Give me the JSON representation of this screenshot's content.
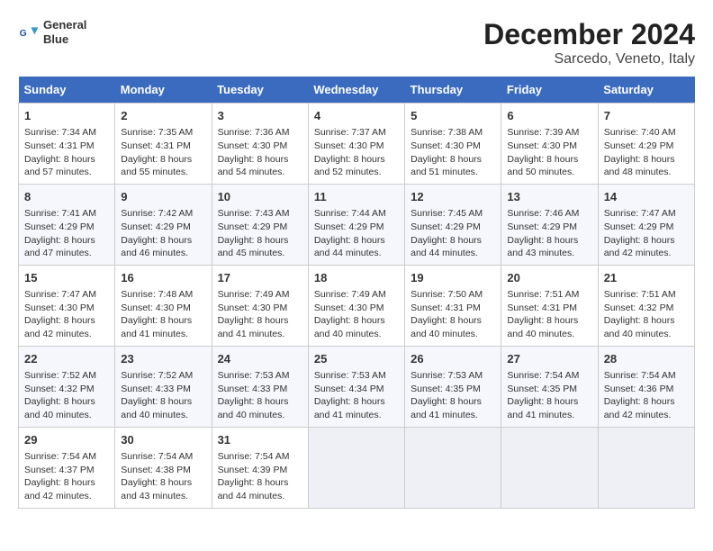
{
  "logo": {
    "line1": "General",
    "line2": "Blue"
  },
  "title": "December 2024",
  "subtitle": "Sarcedo, Veneto, Italy",
  "headers": [
    "Sunday",
    "Monday",
    "Tuesday",
    "Wednesday",
    "Thursday",
    "Friday",
    "Saturday"
  ],
  "weeks": [
    [
      {
        "day": "1",
        "lines": [
          "Sunrise: 7:34 AM",
          "Sunset: 4:31 PM",
          "Daylight: 8 hours",
          "and 57 minutes."
        ]
      },
      {
        "day": "2",
        "lines": [
          "Sunrise: 7:35 AM",
          "Sunset: 4:31 PM",
          "Daylight: 8 hours",
          "and 55 minutes."
        ]
      },
      {
        "day": "3",
        "lines": [
          "Sunrise: 7:36 AM",
          "Sunset: 4:30 PM",
          "Daylight: 8 hours",
          "and 54 minutes."
        ]
      },
      {
        "day": "4",
        "lines": [
          "Sunrise: 7:37 AM",
          "Sunset: 4:30 PM",
          "Daylight: 8 hours",
          "and 52 minutes."
        ]
      },
      {
        "day": "5",
        "lines": [
          "Sunrise: 7:38 AM",
          "Sunset: 4:30 PM",
          "Daylight: 8 hours",
          "and 51 minutes."
        ]
      },
      {
        "day": "6",
        "lines": [
          "Sunrise: 7:39 AM",
          "Sunset: 4:30 PM",
          "Daylight: 8 hours",
          "and 50 minutes."
        ]
      },
      {
        "day": "7",
        "lines": [
          "Sunrise: 7:40 AM",
          "Sunset: 4:29 PM",
          "Daylight: 8 hours",
          "and 48 minutes."
        ]
      }
    ],
    [
      {
        "day": "8",
        "lines": [
          "Sunrise: 7:41 AM",
          "Sunset: 4:29 PM",
          "Daylight: 8 hours",
          "and 47 minutes."
        ]
      },
      {
        "day": "9",
        "lines": [
          "Sunrise: 7:42 AM",
          "Sunset: 4:29 PM",
          "Daylight: 8 hours",
          "and 46 minutes."
        ]
      },
      {
        "day": "10",
        "lines": [
          "Sunrise: 7:43 AM",
          "Sunset: 4:29 PM",
          "Daylight: 8 hours",
          "and 45 minutes."
        ]
      },
      {
        "day": "11",
        "lines": [
          "Sunrise: 7:44 AM",
          "Sunset: 4:29 PM",
          "Daylight: 8 hours",
          "and 44 minutes."
        ]
      },
      {
        "day": "12",
        "lines": [
          "Sunrise: 7:45 AM",
          "Sunset: 4:29 PM",
          "Daylight: 8 hours",
          "and 44 minutes."
        ]
      },
      {
        "day": "13",
        "lines": [
          "Sunrise: 7:46 AM",
          "Sunset: 4:29 PM",
          "Daylight: 8 hours",
          "and 43 minutes."
        ]
      },
      {
        "day": "14",
        "lines": [
          "Sunrise: 7:47 AM",
          "Sunset: 4:29 PM",
          "Daylight: 8 hours",
          "and 42 minutes."
        ]
      }
    ],
    [
      {
        "day": "15",
        "lines": [
          "Sunrise: 7:47 AM",
          "Sunset: 4:30 PM",
          "Daylight: 8 hours",
          "and 42 minutes."
        ]
      },
      {
        "day": "16",
        "lines": [
          "Sunrise: 7:48 AM",
          "Sunset: 4:30 PM",
          "Daylight: 8 hours",
          "and 41 minutes."
        ]
      },
      {
        "day": "17",
        "lines": [
          "Sunrise: 7:49 AM",
          "Sunset: 4:30 PM",
          "Daylight: 8 hours",
          "and 41 minutes."
        ]
      },
      {
        "day": "18",
        "lines": [
          "Sunrise: 7:49 AM",
          "Sunset: 4:30 PM",
          "Daylight: 8 hours",
          "and 40 minutes."
        ]
      },
      {
        "day": "19",
        "lines": [
          "Sunrise: 7:50 AM",
          "Sunset: 4:31 PM",
          "Daylight: 8 hours",
          "and 40 minutes."
        ]
      },
      {
        "day": "20",
        "lines": [
          "Sunrise: 7:51 AM",
          "Sunset: 4:31 PM",
          "Daylight: 8 hours",
          "and 40 minutes."
        ]
      },
      {
        "day": "21",
        "lines": [
          "Sunrise: 7:51 AM",
          "Sunset: 4:32 PM",
          "Daylight: 8 hours",
          "and 40 minutes."
        ]
      }
    ],
    [
      {
        "day": "22",
        "lines": [
          "Sunrise: 7:52 AM",
          "Sunset: 4:32 PM",
          "Daylight: 8 hours",
          "and 40 minutes."
        ]
      },
      {
        "day": "23",
        "lines": [
          "Sunrise: 7:52 AM",
          "Sunset: 4:33 PM",
          "Daylight: 8 hours",
          "and 40 minutes."
        ]
      },
      {
        "day": "24",
        "lines": [
          "Sunrise: 7:53 AM",
          "Sunset: 4:33 PM",
          "Daylight: 8 hours",
          "and 40 minutes."
        ]
      },
      {
        "day": "25",
        "lines": [
          "Sunrise: 7:53 AM",
          "Sunset: 4:34 PM",
          "Daylight: 8 hours",
          "and 41 minutes."
        ]
      },
      {
        "day": "26",
        "lines": [
          "Sunrise: 7:53 AM",
          "Sunset: 4:35 PM",
          "Daylight: 8 hours",
          "and 41 minutes."
        ]
      },
      {
        "day": "27",
        "lines": [
          "Sunrise: 7:54 AM",
          "Sunset: 4:35 PM",
          "Daylight: 8 hours",
          "and 41 minutes."
        ]
      },
      {
        "day": "28",
        "lines": [
          "Sunrise: 7:54 AM",
          "Sunset: 4:36 PM",
          "Daylight: 8 hours",
          "and 42 minutes."
        ]
      }
    ],
    [
      {
        "day": "29",
        "lines": [
          "Sunrise: 7:54 AM",
          "Sunset: 4:37 PM",
          "Daylight: 8 hours",
          "and 42 minutes."
        ]
      },
      {
        "day": "30",
        "lines": [
          "Sunrise: 7:54 AM",
          "Sunset: 4:38 PM",
          "Daylight: 8 hours",
          "and 43 minutes."
        ]
      },
      {
        "day": "31",
        "lines": [
          "Sunrise: 7:54 AM",
          "Sunset: 4:39 PM",
          "Daylight: 8 hours",
          "and 44 minutes."
        ]
      },
      null,
      null,
      null,
      null
    ]
  ]
}
